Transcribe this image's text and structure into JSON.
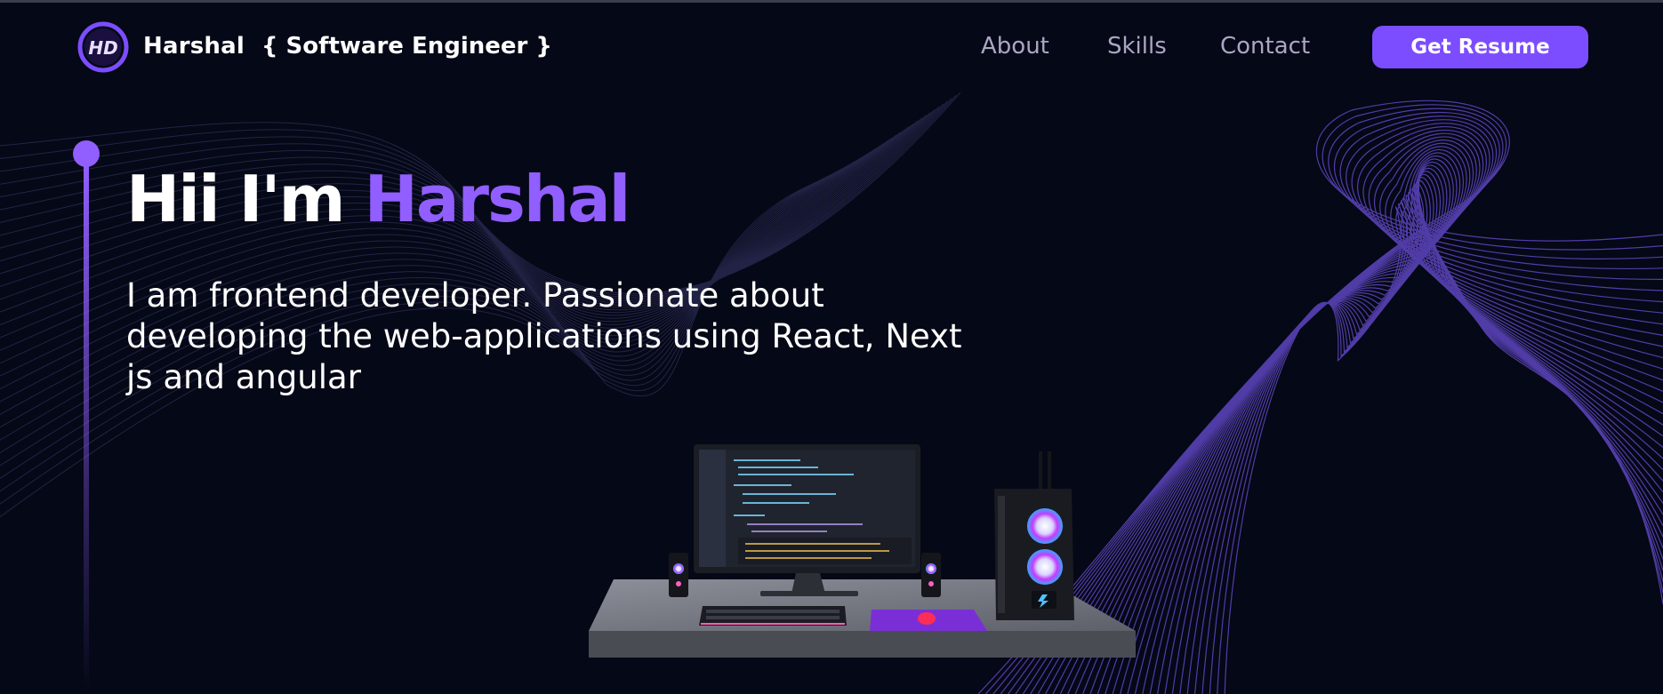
{
  "brand": {
    "logo_initials": "HD",
    "name": "Harshal",
    "title": "{ Software Engineer }"
  },
  "nav": {
    "items": [
      {
        "label": "About"
      },
      {
        "label": "Skills"
      },
      {
        "label": "Contact"
      }
    ],
    "resume_label": "Get Resume"
  },
  "hero": {
    "greeting": "Hii I'm",
    "name": "Harshal",
    "subtitle": "I am frontend developer. Passionate about developing the web-applications using React, Next js and angular"
  },
  "colors": {
    "background": "#050816",
    "accent": "#915eff",
    "button": "#7c4dff",
    "nav_text": "#aaa6c3"
  },
  "icons": {
    "logo": "hd-circle-logo",
    "scene": "desk-computer-setup"
  }
}
